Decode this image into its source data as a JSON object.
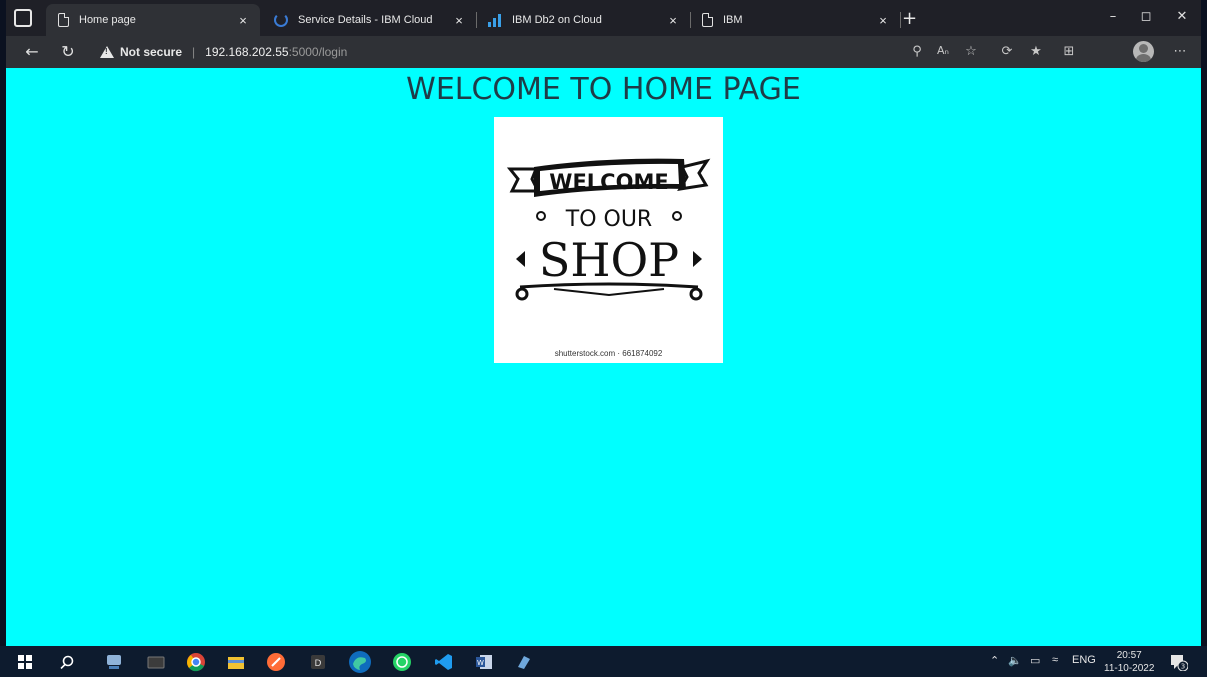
{
  "tabs": [
    {
      "label": "Home page",
      "icon": "page-icon",
      "active": true
    },
    {
      "label": "Service Details - IBM Cloud",
      "icon": "ibm-cloud-icon",
      "active": false
    },
    {
      "label": "IBM Db2 on Cloud",
      "icon": "db2-icon",
      "active": false
    },
    {
      "label": "IBM",
      "icon": "page-icon",
      "active": false
    }
  ],
  "tab_close_glyph": "×",
  "new_tab_glyph": "+",
  "address_bar": {
    "security_label": "Not secure",
    "host": "192.168.202.55",
    "path": ":5000/login"
  },
  "page": {
    "heading": "WELCOME TO HOME PAGE",
    "image": {
      "banner_text": "WELCOME",
      "line2": "TO OUR",
      "line3": "SHOP",
      "watermark": "shutterstock.com · 661874092"
    }
  },
  "taskbar": {
    "language": "ENG",
    "time": "20:57",
    "date": "11-10-2022",
    "notification_count": "3"
  },
  "colors": {
    "page_background": "#00ffff",
    "heading_color": "#1f3c48",
    "taskbar": "#0d1b2e",
    "browser_chrome": "#2f3136"
  }
}
